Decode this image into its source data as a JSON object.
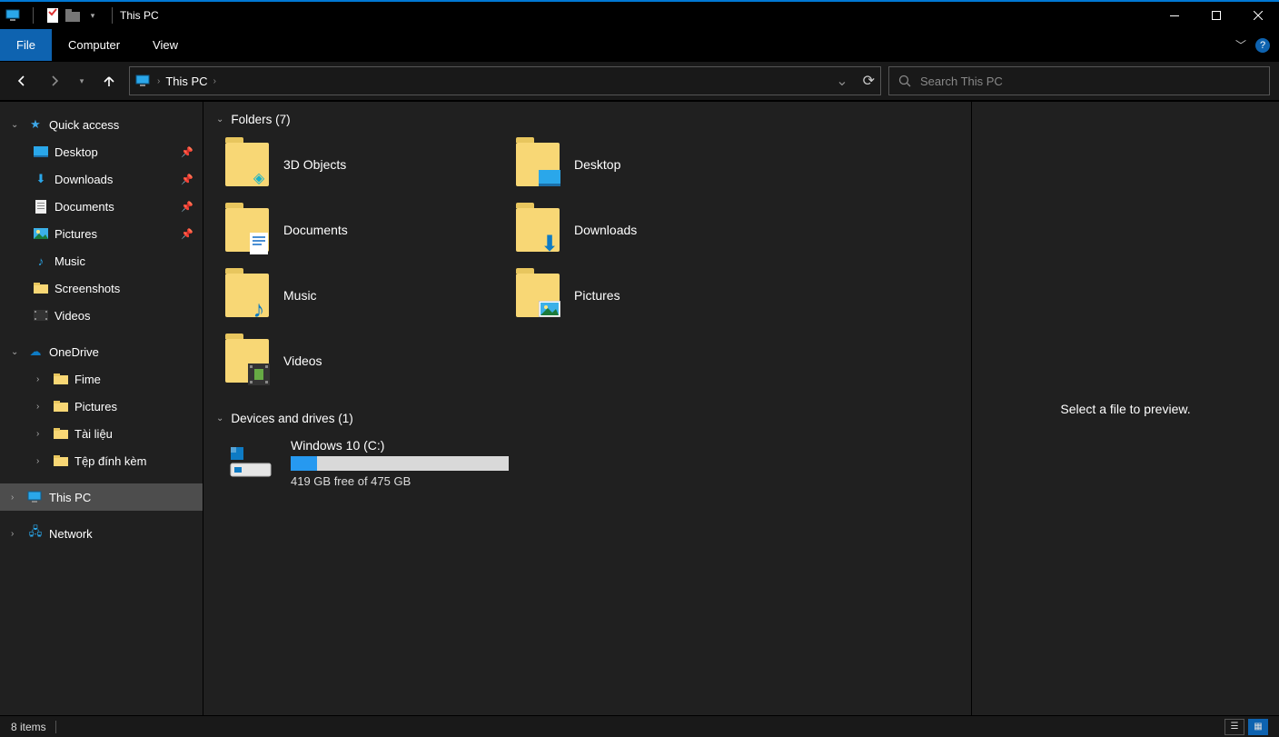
{
  "window": {
    "title": "This PC"
  },
  "ribbon": {
    "file": "File",
    "tabs": [
      "Computer",
      "View"
    ]
  },
  "nav": {
    "location": "This PC",
    "search_placeholder": "Search This PC"
  },
  "sidebar": {
    "quick_access": "Quick access",
    "quick_items": [
      {
        "label": "Desktop",
        "pinned": true
      },
      {
        "label": "Downloads",
        "pinned": true
      },
      {
        "label": "Documents",
        "pinned": true
      },
      {
        "label": "Pictures",
        "pinned": true
      },
      {
        "label": "Music",
        "pinned": false
      },
      {
        "label": "Screenshots",
        "pinned": false
      },
      {
        "label": "Videos",
        "pinned": false
      }
    ],
    "onedrive": "OneDrive",
    "onedrive_items": [
      {
        "label": "Fime"
      },
      {
        "label": "Pictures"
      },
      {
        "label": "Tài liệu"
      },
      {
        "label": "Tệp đính kèm"
      }
    ],
    "this_pc": "This PC",
    "network": "Network"
  },
  "content": {
    "folders_header": "Folders (7)",
    "folders": [
      {
        "label": "3D Objects"
      },
      {
        "label": "Desktop"
      },
      {
        "label": "Documents"
      },
      {
        "label": "Downloads"
      },
      {
        "label": "Music"
      },
      {
        "label": "Pictures"
      },
      {
        "label": "Videos"
      }
    ],
    "drives_header": "Devices and drives (1)",
    "drive": {
      "name": "Windows 10 (C:)",
      "free_text": "419 GB free of 475 GB",
      "used_percent": 12
    }
  },
  "preview": {
    "empty_text": "Select a file to preview."
  },
  "status": {
    "items": "8 items"
  }
}
